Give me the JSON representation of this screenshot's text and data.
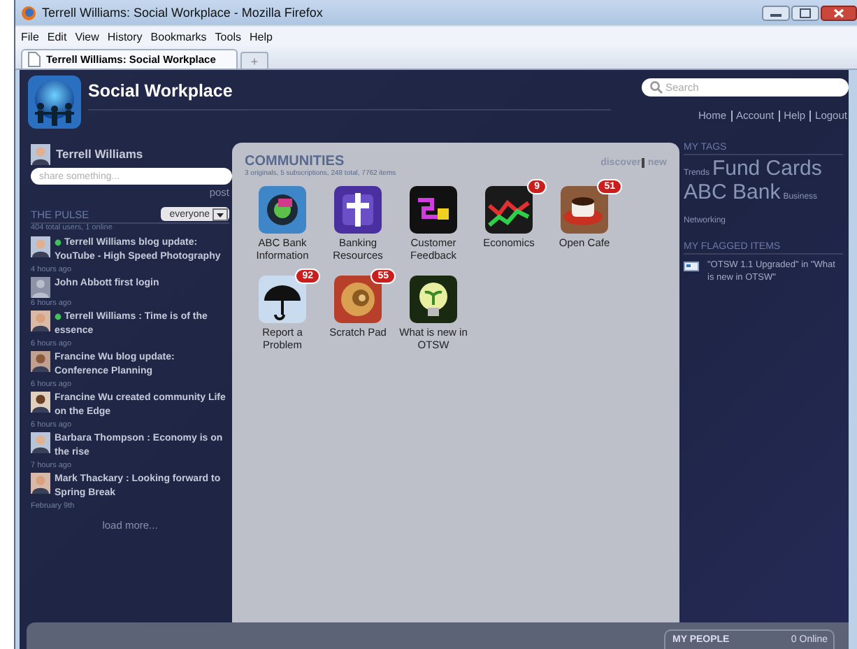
{
  "browser": {
    "title": "Terrell Williams: Social Workplace - Mozilla Firefox",
    "menu": [
      "File",
      "Edit",
      "View",
      "History",
      "Bookmarks",
      "Tools",
      "Help"
    ],
    "tabs": [
      {
        "label": "Terrell Williams: Social Workplace",
        "selected": true
      }
    ],
    "new_tab": "+"
  },
  "site": {
    "title": "Social Workplace",
    "search": {
      "placeholder": "Search"
    },
    "nav_links": [
      "Home",
      "Account",
      "Help",
      "Logout"
    ]
  },
  "user": {
    "name": "Terrell Williams",
    "share": {
      "placeholder": "share something..."
    },
    "post": "post"
  },
  "pulse": {
    "title": "THE PULSE",
    "filter": "everyone",
    "summary": "404 total users, 1 online",
    "items": [
      {
        "text": "Terrell Williams blog update: YouTube - High Speed Photography",
        "time": "4 hours ago",
        "online": true,
        "kind": "photo"
      },
      {
        "text": "John Abbott first login",
        "time": "6 hours ago",
        "online": false,
        "kind": "placeholder"
      },
      {
        "text": "Terrell Williams : Time is of the essence",
        "time": "6 hours ago",
        "online": true,
        "kind": "photo"
      },
      {
        "text": "Francine Wu blog update: Conference Planning",
        "time": "6 hours ago",
        "online": false,
        "kind": "photo"
      },
      {
        "text": "Francine Wu created community Life on the Edge",
        "time": "6 hours ago",
        "online": false,
        "kind": "photo"
      },
      {
        "text": "Barbara Thompson : Economy is on the rise",
        "time": "7 hours ago",
        "online": false,
        "kind": "photo"
      },
      {
        "text": "Mark Thackary : Looking forward to Spring Break",
        "time": "February 9th",
        "online": false,
        "kind": "photo"
      }
    ],
    "load_more": "load more..."
  },
  "communities": {
    "title": "COMMUNITIES",
    "summary": "3 originals, 5 subscriptions, 248 total, 7762 items",
    "links": [
      "discover",
      "new"
    ],
    "items": [
      {
        "label": "ABC Bank Information"
      },
      {
        "label": "Banking Resources"
      },
      {
        "label": "Customer Feedback"
      },
      {
        "label": "Economics",
        "badge": "9"
      },
      {
        "label": "Open Cafe",
        "badge": "51"
      },
      {
        "label": "Report a Problem",
        "badge": "92"
      },
      {
        "label": "Scratch Pad",
        "badge": "55"
      },
      {
        "label": "What is new in OTSW"
      }
    ]
  },
  "tags": {
    "title": "MY TAGS",
    "items": [
      "Trends",
      "Fund Cards",
      "ABC Bank",
      "Business",
      "Networking"
    ]
  },
  "flagged": {
    "title": "MY FLAGGED ITEMS",
    "items": [
      "\"OTSW 1.1 Upgraded\" in \"What is new in OTSW\""
    ]
  },
  "people": {
    "title": "MY PEOPLE",
    "status": "0 Online"
  }
}
